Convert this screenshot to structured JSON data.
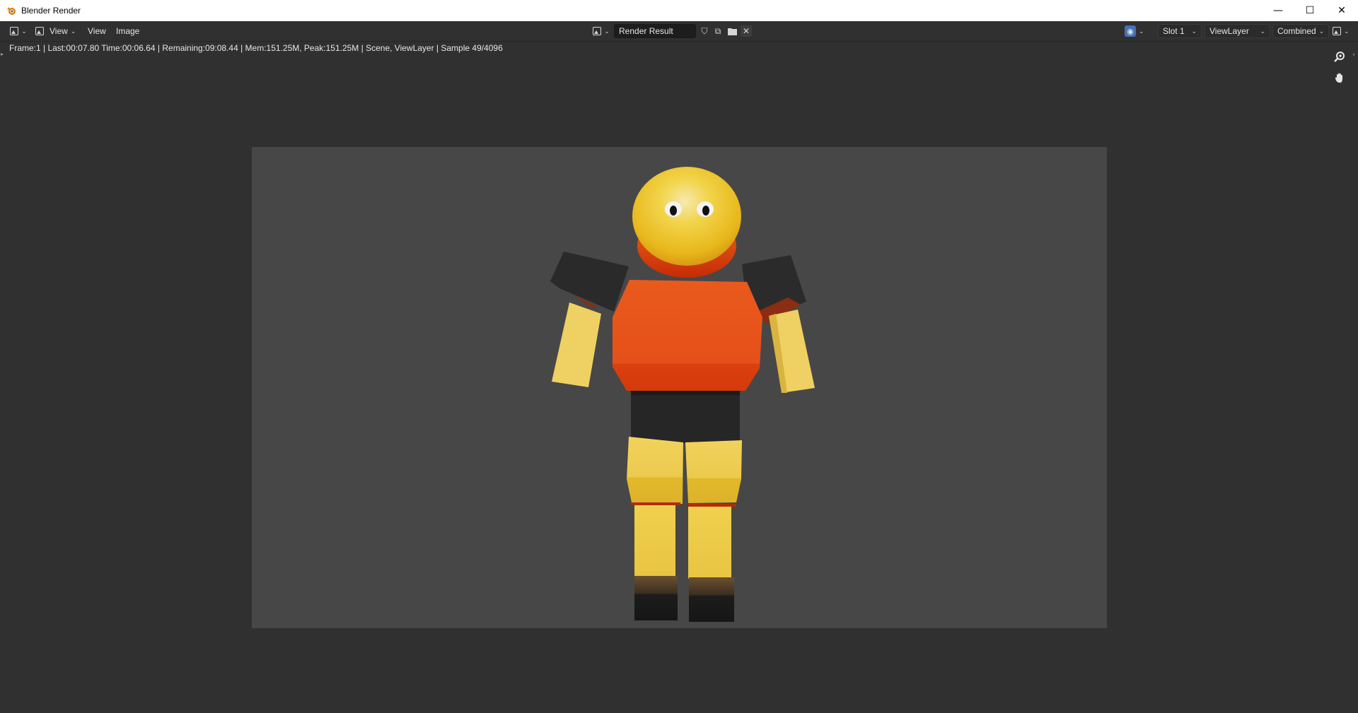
{
  "window": {
    "title": "Blender Render",
    "controls": {
      "minimize": "—",
      "maximize": "☐",
      "close": "✕"
    }
  },
  "header": {
    "menus": [
      "View",
      "View",
      "Image"
    ],
    "image_name": "Render Result",
    "slot": "Slot 1",
    "view_layer": "ViewLayer",
    "pass": "Combined"
  },
  "status": {
    "text": "Frame:1 | Last:00:07.80 Time:00:06.64 | Remaining:09:08.44 | Mem:151.25M, Peak:151.25M | Scene, ViewLayer | Sample 49/4096"
  },
  "colors": {
    "background": "#303030",
    "canvas": "#474747",
    "accent": "#4772b3",
    "body_orange": "#e65a1a",
    "skin_yellow": "#f0cc50",
    "dark": "#2a2a2a"
  },
  "icons": {
    "logo": "blender-logo-icon",
    "editor_type": "image-editor-icon",
    "browse": "image-browse-icon",
    "fake_user": "shield-icon",
    "duplicate": "duplicate-icon",
    "open": "folder-icon",
    "unlink": "close-icon",
    "overlay": "overlay-globe-icon",
    "display_mode": "display-channels-icon",
    "zoom": "zoom-icon",
    "pan": "hand-icon"
  }
}
